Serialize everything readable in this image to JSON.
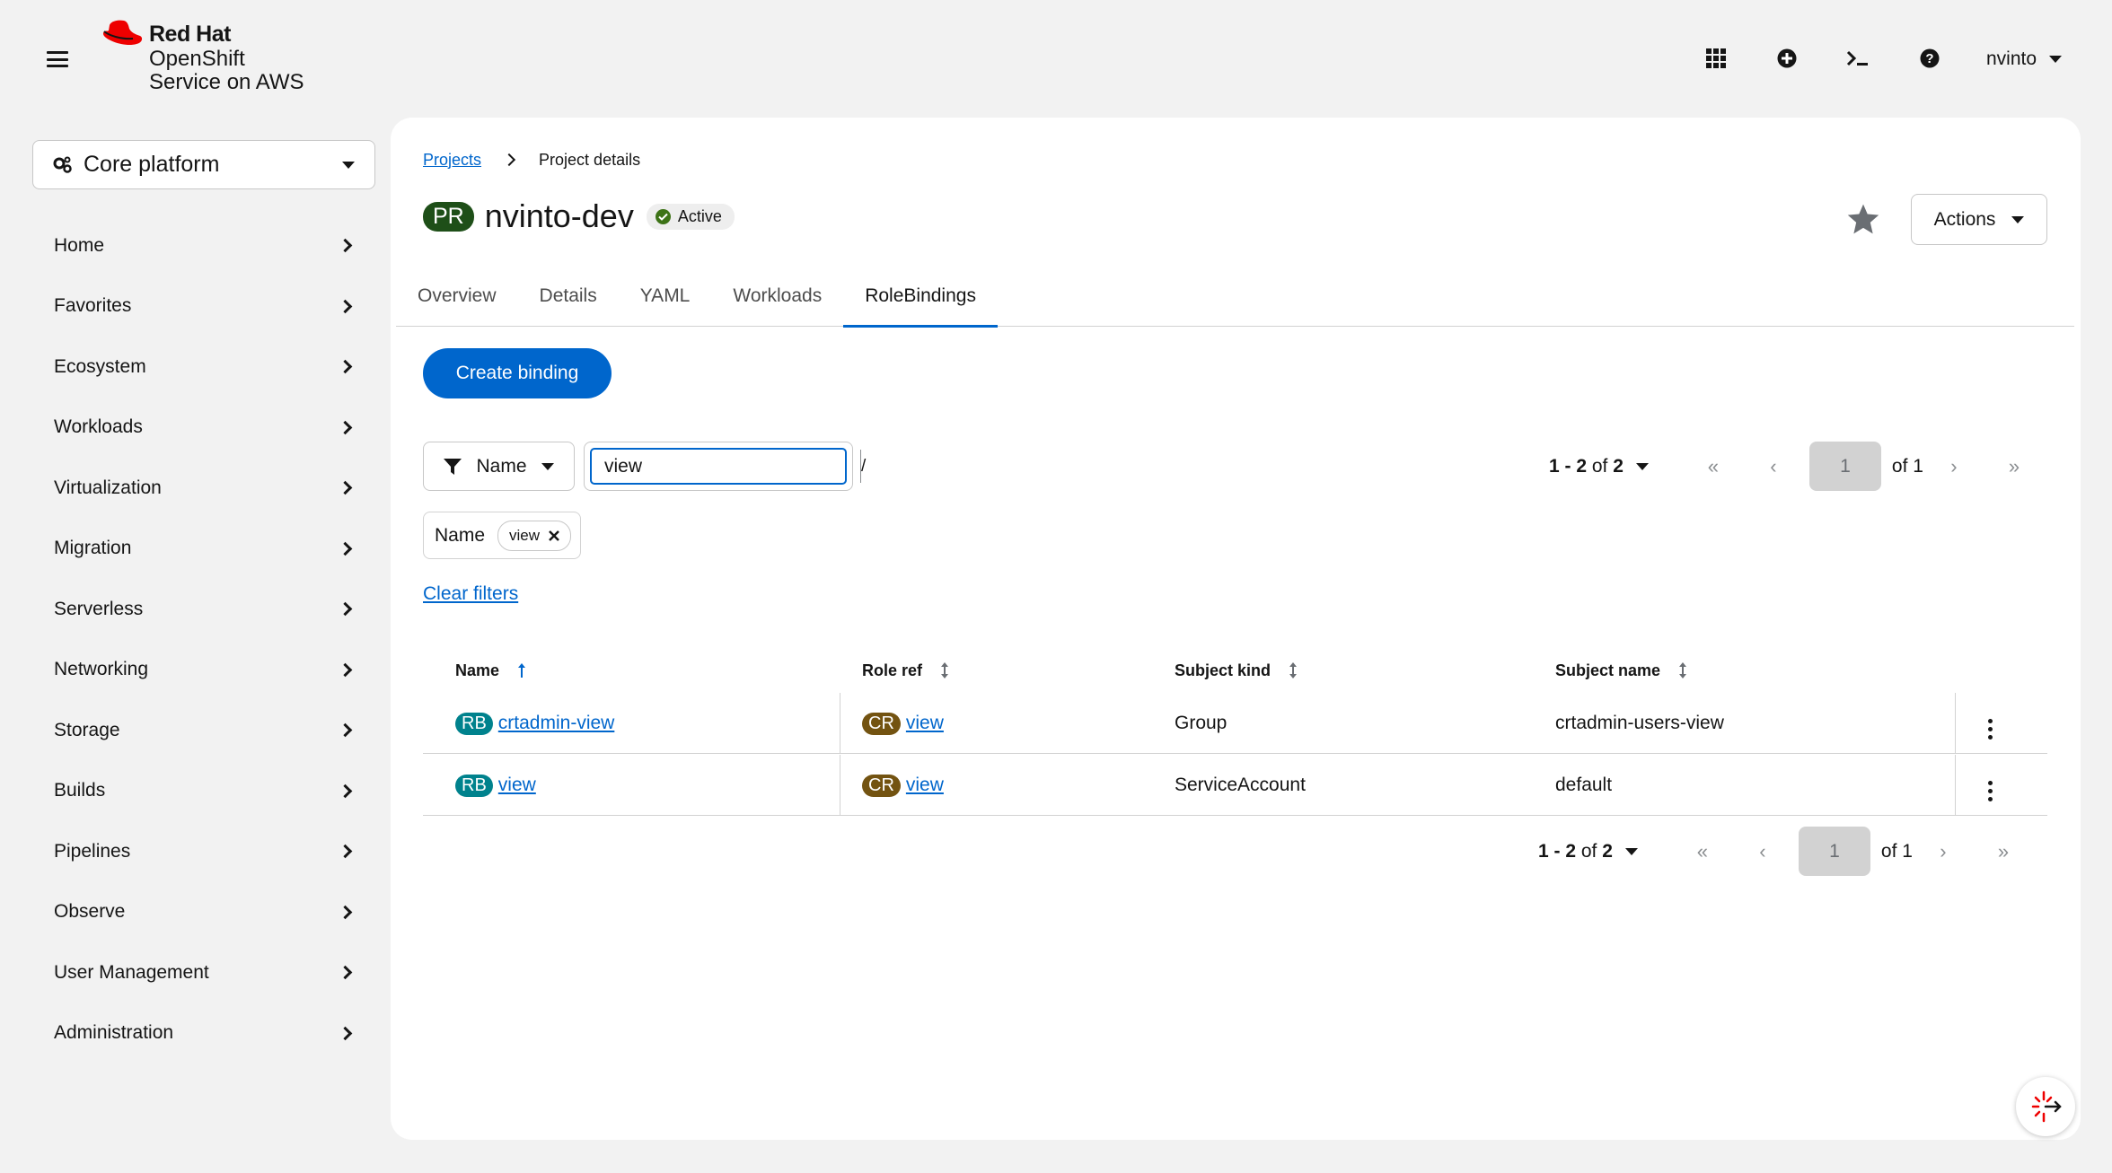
{
  "masthead": {
    "brand": "Red Hat",
    "product_line1": "OpenShift",
    "product_line2": "Service on AWS",
    "icons": [
      "grid-icon",
      "plus-circle-icon",
      "terminal-icon",
      "help-icon"
    ],
    "user": "nvinto"
  },
  "sidebar": {
    "perspective": "Core platform",
    "items": [
      {
        "label": "Home"
      },
      {
        "label": "Favorites"
      },
      {
        "label": "Ecosystem"
      },
      {
        "label": "Workloads"
      },
      {
        "label": "Virtualization"
      },
      {
        "label": "Migration"
      },
      {
        "label": "Serverless"
      },
      {
        "label": "Networking"
      },
      {
        "label": "Storage"
      },
      {
        "label": "Builds"
      },
      {
        "label": "Pipelines"
      },
      {
        "label": "Observe"
      },
      {
        "label": "User Management"
      },
      {
        "label": "Administration"
      }
    ]
  },
  "breadcrumb": {
    "parent": "Projects",
    "current": "Project details"
  },
  "project": {
    "badge": "PR",
    "name": "nvinto-dev",
    "status": "Active"
  },
  "actions_label": "Actions",
  "tabs": [
    {
      "label": "Overview"
    },
    {
      "label": "Details"
    },
    {
      "label": "YAML"
    },
    {
      "label": "Workloads"
    },
    {
      "label": "RoleBindings",
      "active": true
    }
  ],
  "toolbar": {
    "create_label": "Create binding",
    "filter_type": "Name",
    "search_value": "view",
    "search_shortcut": "/",
    "chip_group_label": "Name",
    "chip_value": "view",
    "clear_filters": "Clear filters"
  },
  "pagination": {
    "range": "1 - 2",
    "of_label": "of",
    "total": "2",
    "page": "1",
    "pages_label": "of 1"
  },
  "table": {
    "columns": [
      "Name",
      "Role ref",
      "Subject kind",
      "Subject name"
    ],
    "rows": [
      {
        "name_badge": "RB",
        "name": "crtadmin-view",
        "role_badge": "CR",
        "role": "view",
        "kind": "Group",
        "subject": "crtadmin-users-view"
      },
      {
        "name_badge": "RB",
        "name": "view",
        "role_badge": "CR",
        "role": "view",
        "kind": "ServiceAccount",
        "subject": "default"
      }
    ]
  },
  "colors": {
    "accent": "#0066cc",
    "project_badge": "#1e4f18",
    "rb_badge": "#00828d",
    "cr_badge": "#735311",
    "status_ok": "#3d7317"
  }
}
